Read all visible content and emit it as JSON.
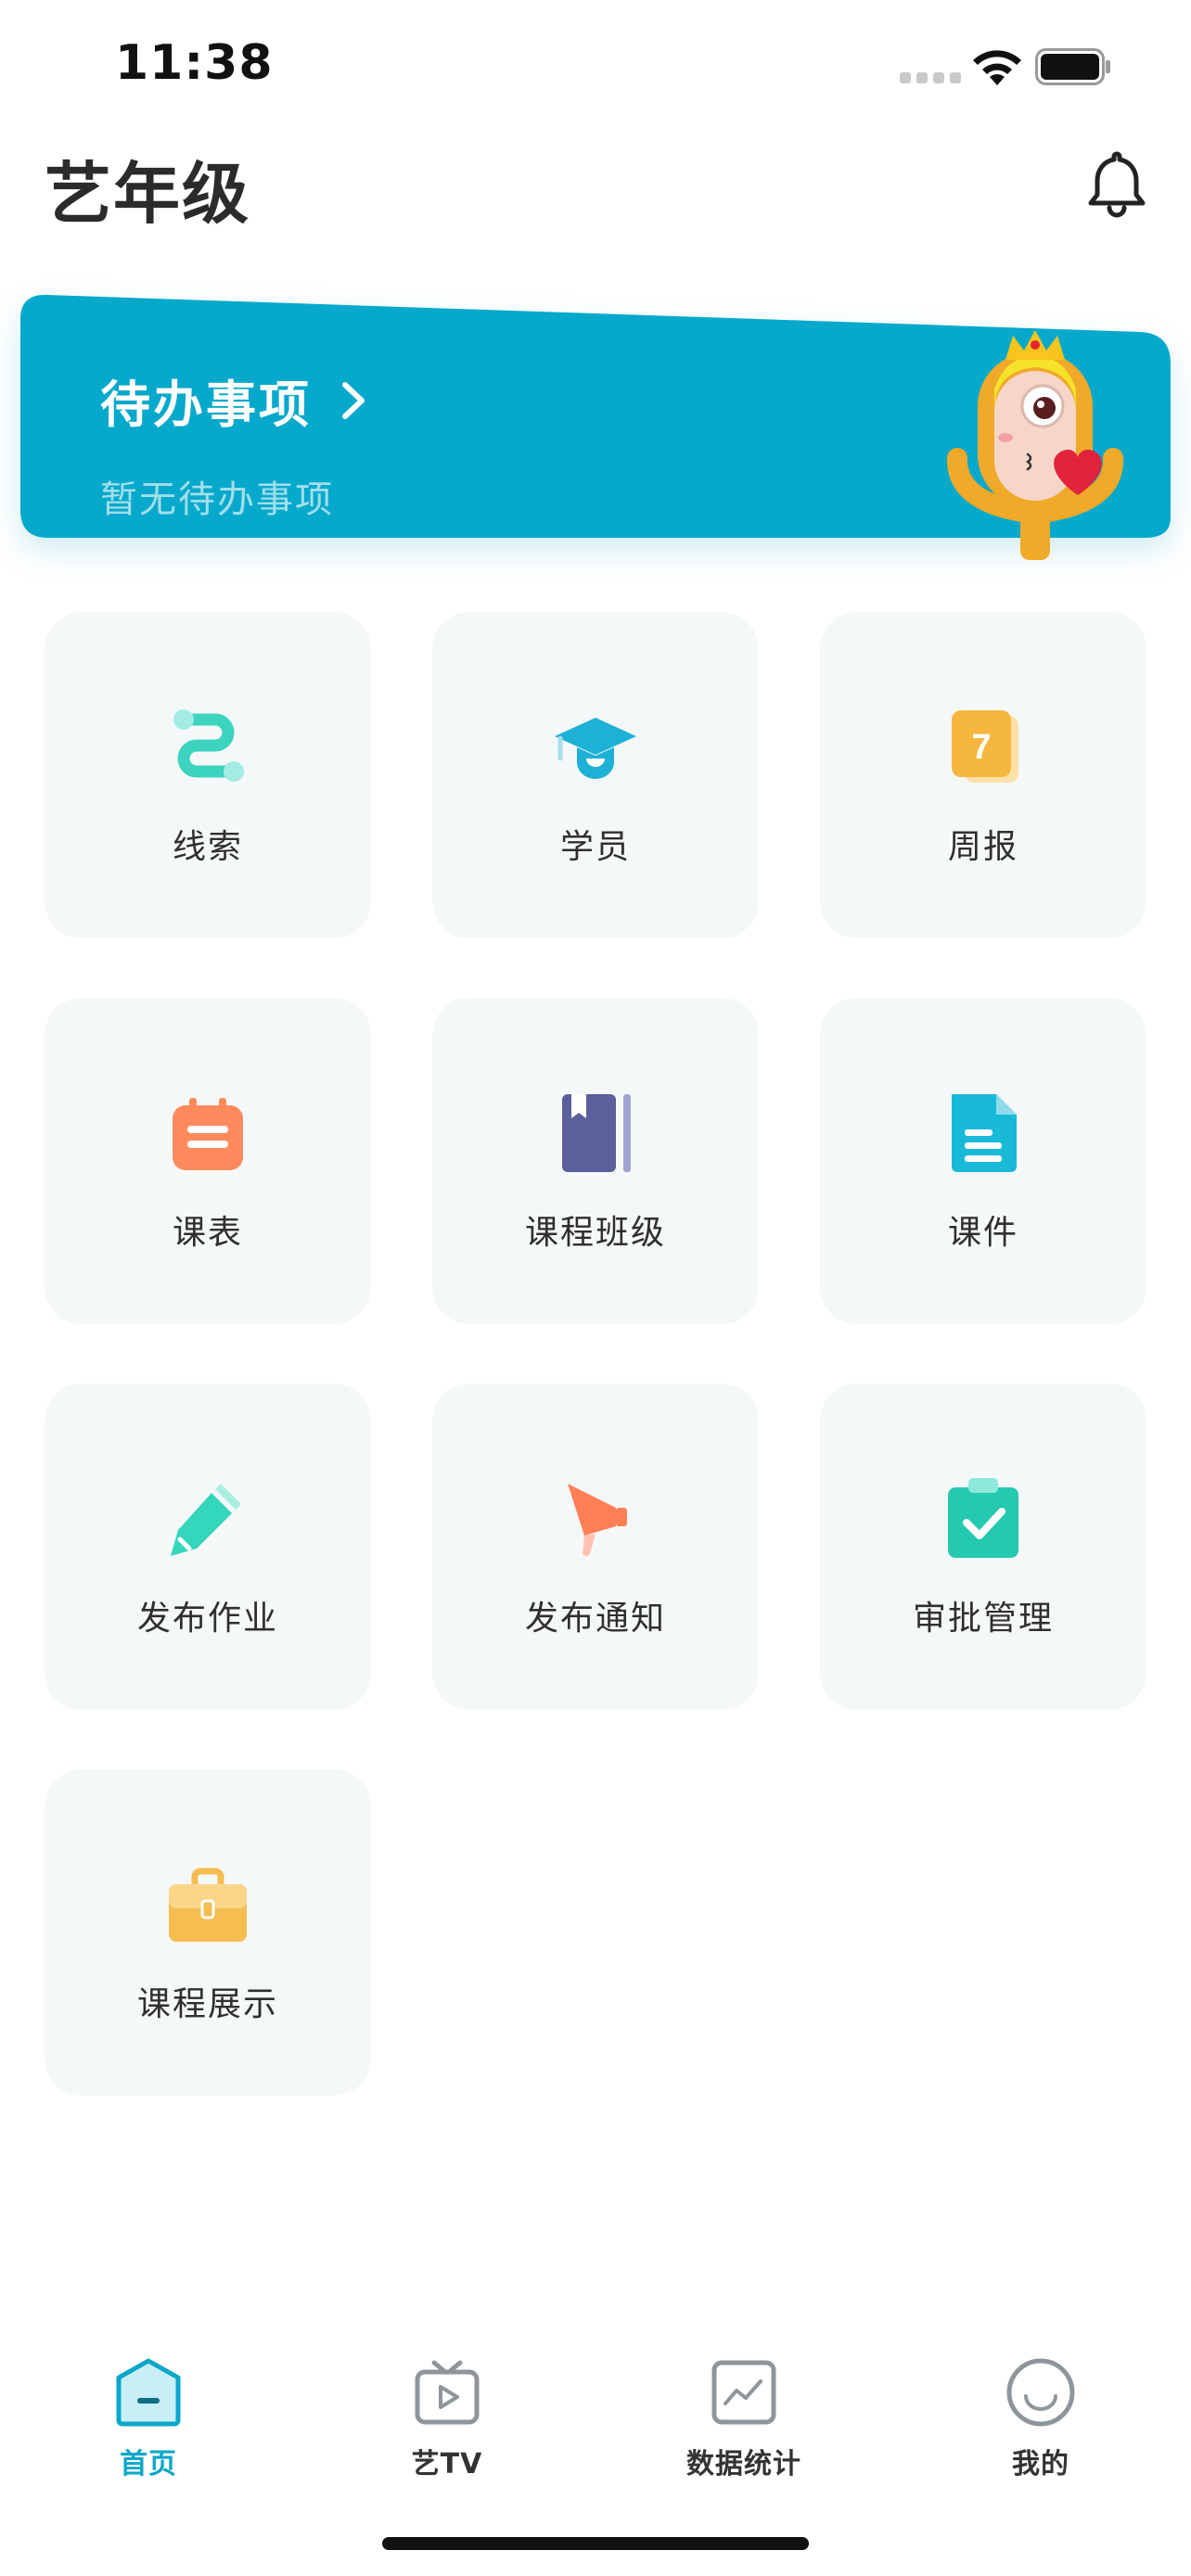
{
  "status_bar": {
    "time": "11:38"
  },
  "header": {
    "title": "艺年级"
  },
  "todo_banner": {
    "title": "待办事项",
    "subtitle": "暂无待办事项",
    "bg_color": "#06a9cb"
  },
  "menu": {
    "items": [
      {
        "label": "线索",
        "icon": "clue-icon"
      },
      {
        "label": "学员",
        "icon": "graduation-cap-icon"
      },
      {
        "label": "周报",
        "icon": "calendar-7-icon"
      },
      {
        "label": "课表",
        "icon": "schedule-icon"
      },
      {
        "label": "课程班级",
        "icon": "book-icon"
      },
      {
        "label": "课件",
        "icon": "document-icon"
      },
      {
        "label": "发布作业",
        "icon": "pencil-icon"
      },
      {
        "label": "发布通知",
        "icon": "megaphone-icon"
      },
      {
        "label": "审批管理",
        "icon": "clipboard-check-icon"
      },
      {
        "label": "课程展示",
        "icon": "briefcase-icon"
      }
    ]
  },
  "tabbar": {
    "tabs": [
      {
        "label": "首页",
        "icon": "home-icon",
        "active": true
      },
      {
        "label": "艺TV",
        "icon": "tv-icon",
        "active": false
      },
      {
        "label": "数据统计",
        "icon": "chart-icon",
        "active": false
      },
      {
        "label": "我的",
        "icon": "smile-icon",
        "active": false
      }
    ],
    "active_color": "#0aa7c9"
  }
}
